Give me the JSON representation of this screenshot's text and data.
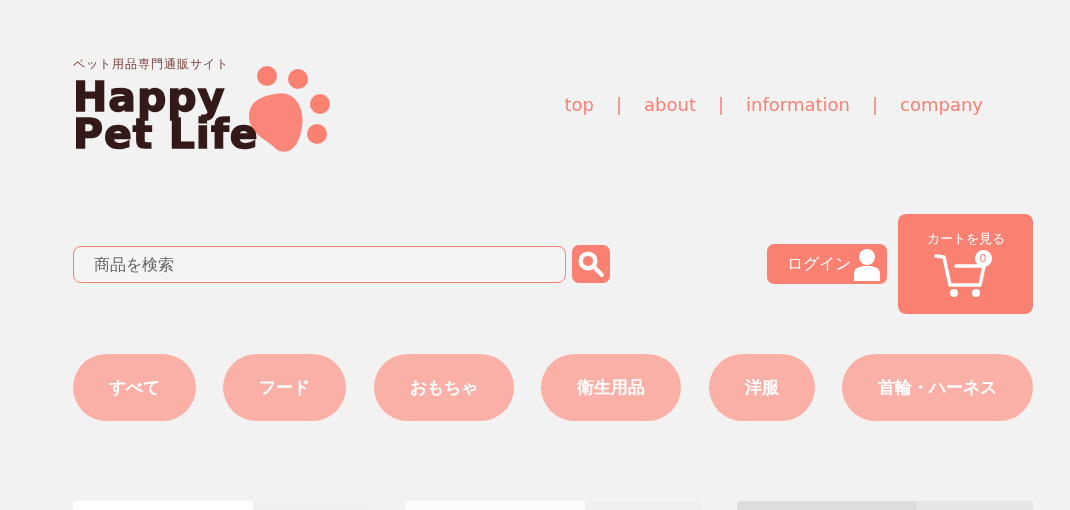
{
  "logo": {
    "tagline": "ペット用品専門通販サイト",
    "title_line_1": "Happy",
    "title_line_2": "Pet Life"
  },
  "nav": [
    {
      "label": "top"
    },
    {
      "label": "about"
    },
    {
      "label": "information"
    },
    {
      "label": "company"
    }
  ],
  "nav_separator": "|",
  "search": {
    "placeholder": "商品を検索"
  },
  "login": {
    "label": "ログイン"
  },
  "cart": {
    "label": "カートを見る",
    "count": "0"
  },
  "categories": [
    {
      "label": "すべて"
    },
    {
      "label": "フード"
    },
    {
      "label": "おもちゃ"
    },
    {
      "label": "衛生用品"
    },
    {
      "label": "洋服"
    },
    {
      "label": "首輪・ハーネス"
    }
  ]
}
